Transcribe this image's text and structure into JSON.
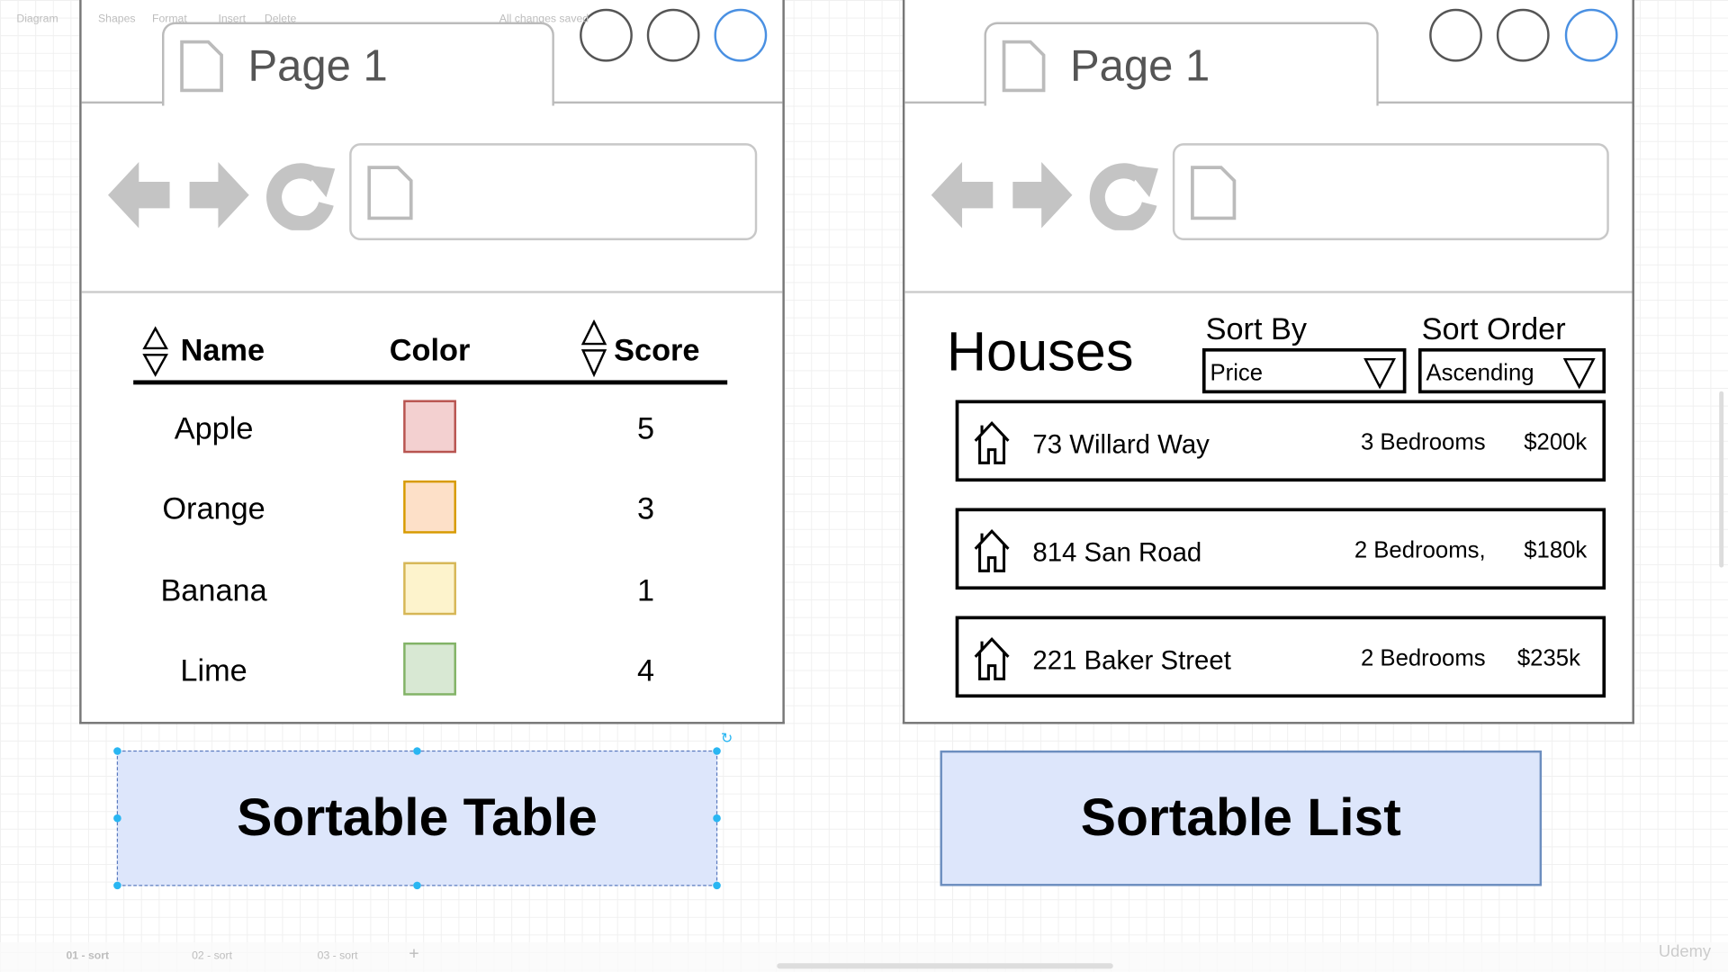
{
  "toolbar": {
    "diagram": "Diagram",
    "shapes": "Shapes",
    "format": "Format",
    "insert": "Insert",
    "delete": "Delete",
    "status": "All changes saved"
  },
  "page_tabs": [
    "01 - sort",
    "02 - sort",
    "03 - sort"
  ],
  "watermark": "Udemy",
  "left_mockup": {
    "tab_title": "Page 1",
    "headers": {
      "name": "Name",
      "color": "Color",
      "score": "Score"
    },
    "rows": [
      {
        "name": "Apple",
        "fill": "#f3d0d0",
        "stroke": "#b85450",
        "score": "5"
      },
      {
        "name": "Orange",
        "fill": "#fde0c8",
        "stroke": "#d79b00",
        "score": "3"
      },
      {
        "name": "Banana",
        "fill": "#fdf3cc",
        "stroke": "#d6b656",
        "score": "1"
      },
      {
        "name": "Lime",
        "fill": "#d8e8d3",
        "stroke": "#82b366",
        "score": "4"
      }
    ],
    "caption": "Sortable Table"
  },
  "right_mockup": {
    "tab_title": "Page 1",
    "heading": "Houses",
    "sort_by_label": "Sort By",
    "sort_by_value": "Price",
    "sort_order_label": "Sort Order",
    "sort_order_value": "Ascending",
    "items": [
      {
        "address": "73 Willard Way",
        "bedrooms": "3 Bedrooms",
        "price": "$200k"
      },
      {
        "address": "814 San Road",
        "bedrooms": "2 Bedrooms,",
        "price": "$180k"
      },
      {
        "address": "221 Baker Street",
        "bedrooms": "2 Bedrooms",
        "price": "$235k"
      }
    ],
    "caption": "Sortable List"
  }
}
